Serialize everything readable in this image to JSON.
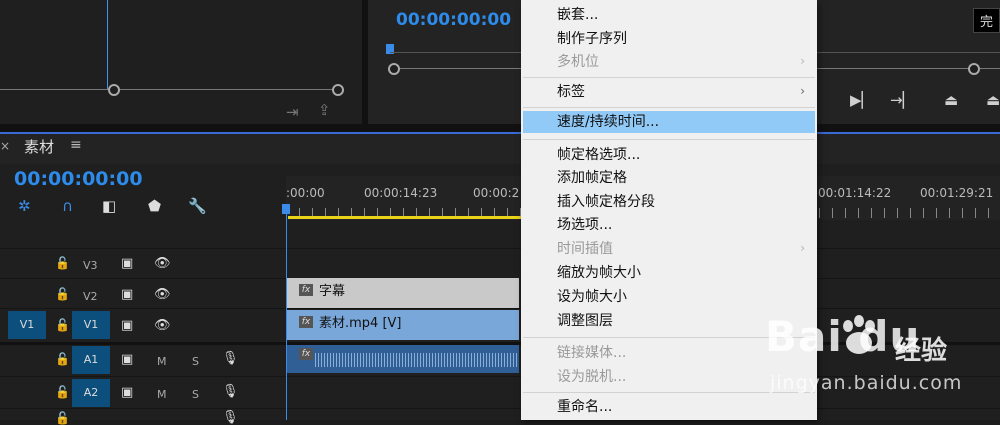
{
  "program_monitor": {
    "timecode": "00:00:00:00",
    "finish_badge": "完"
  },
  "timeline": {
    "tab_label": "素材",
    "tab_close": "×",
    "tab_menu": "≡",
    "timecode": "00:00:00:00",
    "ruler_labels": [
      ":00:00",
      "00:00:14:23",
      "00:00:2",
      "00:01:14:22",
      "00:01:29:21"
    ],
    "tracks": [
      {
        "label": "V3",
        "source": ""
      },
      {
        "label": "V2",
        "source": ""
      },
      {
        "label": "V1",
        "source": "V1"
      },
      {
        "label": "A1",
        "source": "",
        "m": "M",
        "s": "S"
      },
      {
        "label": "A2",
        "source": "",
        "m": "M",
        "s": "S"
      }
    ],
    "clips": {
      "fx": "fx",
      "title": "字幕",
      "video": "素材.mp4 [V]"
    }
  },
  "context_menu": {
    "items": [
      {
        "label": "嵌套...",
        "enabled": true
      },
      {
        "label": "制作子序列",
        "enabled": true
      },
      {
        "label": "多机位",
        "enabled": false,
        "submenu": true
      },
      {
        "label": "标签",
        "enabled": true,
        "submenu": true
      },
      {
        "label": "速度/持续时间...",
        "enabled": true,
        "highlighted": true
      },
      {
        "label": "帧定格选项...",
        "enabled": true
      },
      {
        "label": "添加帧定格",
        "enabled": true
      },
      {
        "label": "插入帧定格分段",
        "enabled": true
      },
      {
        "label": "场选项...",
        "enabled": true
      },
      {
        "label": "时间插值",
        "enabled": false,
        "submenu": true
      },
      {
        "label": "缩放为帧大小",
        "enabled": true
      },
      {
        "label": "设为帧大小",
        "enabled": true
      },
      {
        "label": "调整图层",
        "enabled": true
      },
      {
        "label": "链接媒体...",
        "enabled": false
      },
      {
        "label": "设为脱机...",
        "enabled": false
      },
      {
        "label": "重命名...",
        "enabled": true
      }
    ],
    "submenu_arrow": "›"
  },
  "watermark": {
    "logo_text": "Bai du",
    "logo_cn": "经验",
    "url": "jingyan.baidu.com"
  },
  "colors": {
    "accent": "#2d8ceb",
    "highlight": "#91c9f7",
    "work_area": "#e8d31a"
  }
}
